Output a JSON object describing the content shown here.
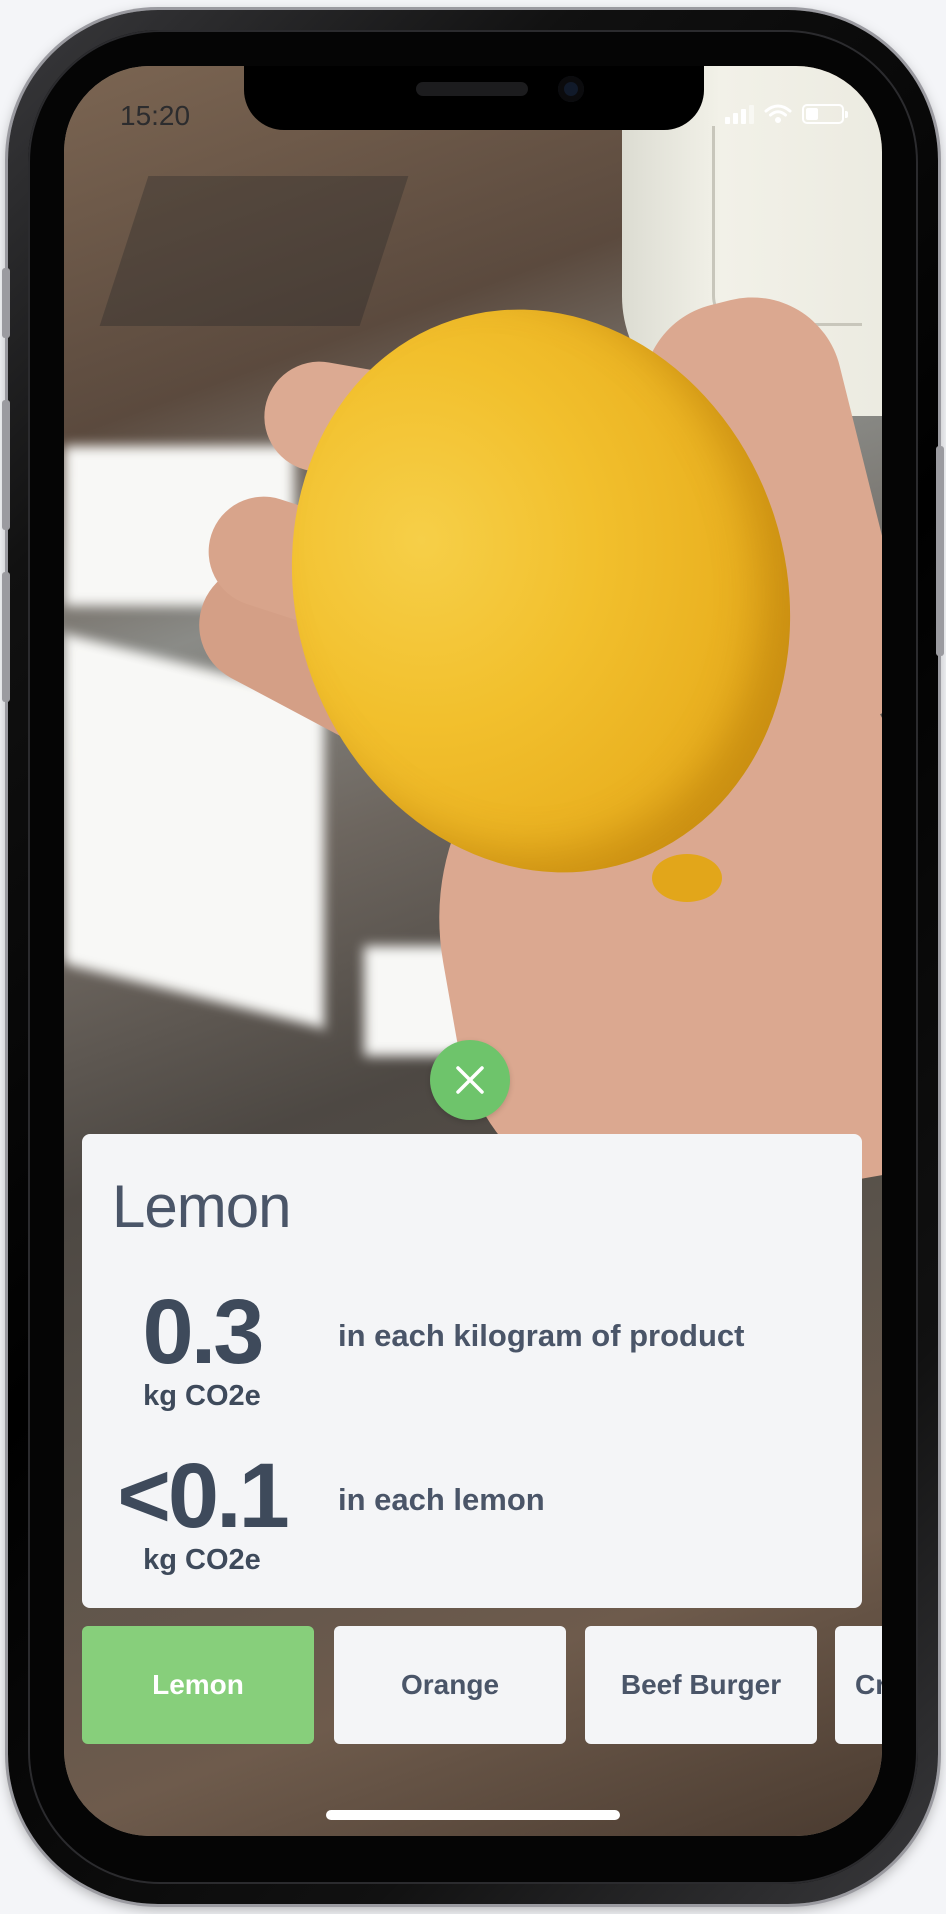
{
  "status_bar": {
    "time": "15:20",
    "icons": [
      "signal-icon",
      "wifi-icon",
      "battery-icon"
    ],
    "battery_level": 0.35
  },
  "close_button": {
    "icon": "close-icon",
    "color": "#6ec46b"
  },
  "product_card": {
    "name": "Lemon",
    "metrics": [
      {
        "value": "0.3",
        "unit": "kg CO2e",
        "description": "in each kilogram of product"
      },
      {
        "value": "<0.1",
        "unit": "kg CO2e",
        "description": "in each lemon"
      }
    ]
  },
  "product_chips": [
    {
      "label": "Lemon",
      "selected": true
    },
    {
      "label": "Orange",
      "selected": false
    },
    {
      "label": "Beef Burger",
      "selected": false
    },
    {
      "label": "Cr",
      "selected": false
    }
  ],
  "colors": {
    "accent_green": "#87cf7b",
    "text_dark": "#3e4a5b",
    "card_bg": "#f4f5f7"
  }
}
